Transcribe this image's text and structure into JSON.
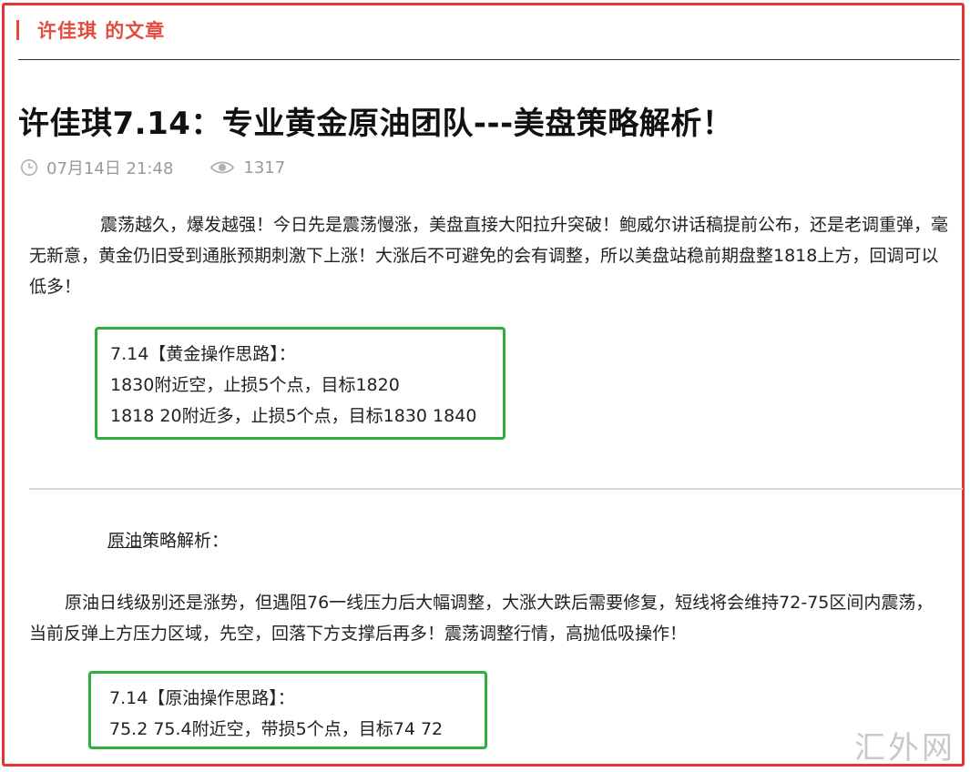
{
  "section": {
    "author_name": "许佳琪",
    "heading_suffix": " 的文章"
  },
  "article": {
    "title": "许佳琪7.14：专业黄金原油团队---美盘策略解析！",
    "date": "07月14日 21:48",
    "views": "1317",
    "icons": {
      "date": "clock-icon",
      "views": "eye-icon"
    },
    "intro": "震荡越久，爆发越强！今日先是震荡慢涨，美盘直接大阳拉升突破！鲍威尔讲话稿提前公布，还是老调重弹，毫无新意，黄金仍旧受到通胀预期刺激下上涨！大涨后不可避免的会有调整，所以美盘站稳前期盘整1818上方，回调可以低多！",
    "gold_box": {
      "title": "7.14【黄金操作思路】：",
      "line1": "1830附近空，止损5个点，目标1820",
      "line2": "1818 20附近多，止损5个点，目标1830 1840"
    },
    "oil_heading_link": "原油",
    "oil_heading_rest": "策略解析：",
    "oil_text": "原油日线级别还是涨势，但遇阻76一线压力后大幅调整，大涨大跌后需要修复，短线将会维持72-75区间内震荡，当前反弹上方压力区域，先空，回落下方支撑后再多！震荡调整行情，高抛低吸操作！",
    "oil_box": {
      "title": "7.14【原油操作思路】：",
      "line1": "75.2 75.4附近空，带损5个点，目标74 72"
    }
  },
  "watermark": "汇外网",
  "colors": {
    "accent_red": "#e54b3c",
    "frame_red": "#e53333",
    "box_green": "#2ab03a",
    "meta_gray": "#9a9a9a"
  }
}
